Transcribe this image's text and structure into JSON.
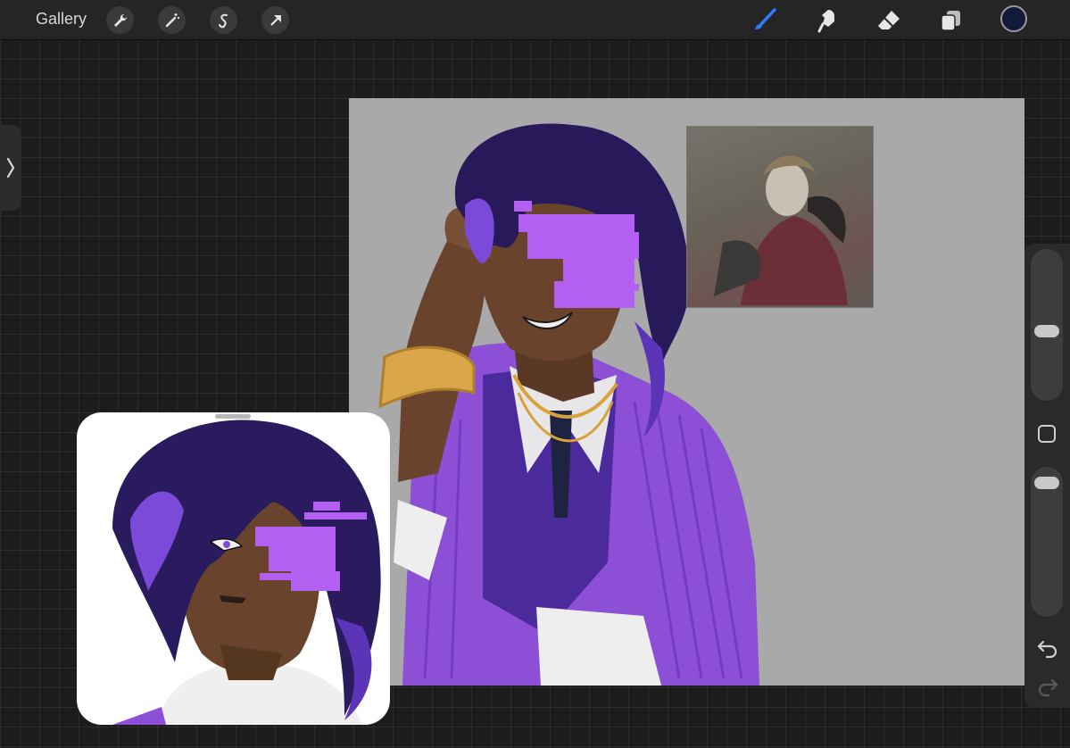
{
  "toolbar": {
    "gallery_label": "Gallery",
    "left_tools": [
      "wrench-icon",
      "magic-wand-icon",
      "selection-icon",
      "transform-arrow-icon"
    ],
    "right_tools": [
      "brush-icon",
      "smudge-icon",
      "eraser-icon",
      "layers-icon"
    ],
    "active_tool": "brush-icon",
    "accent_color": "#2f7bf5",
    "current_color": "#121a3a"
  },
  "sidebar": {
    "brush_size_level": 0.45,
    "opacity_level": 0.95,
    "icons": [
      "modifier-square-icon",
      "undo-icon",
      "redo-icon"
    ]
  },
  "canvas": {
    "background_color": "#a9a9a9"
  }
}
